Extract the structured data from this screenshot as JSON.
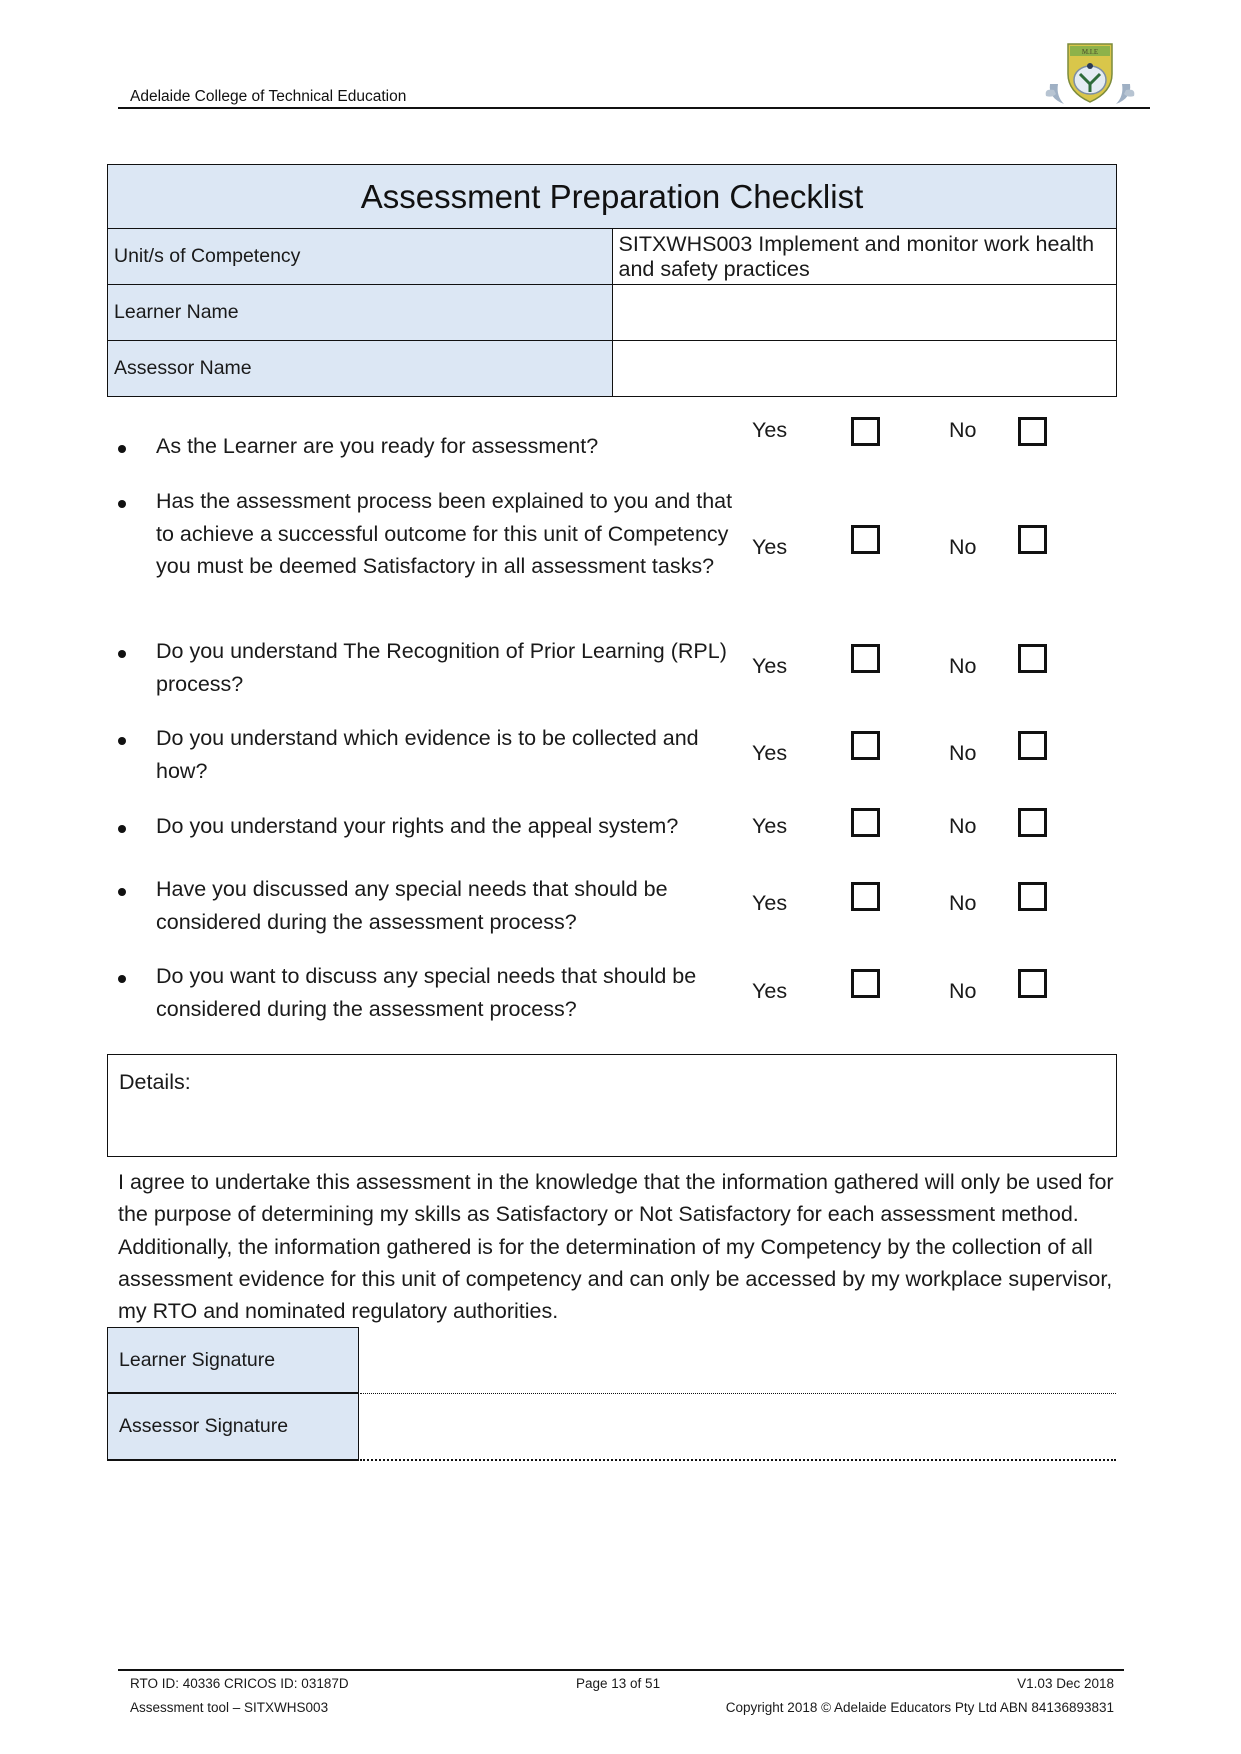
{
  "header": {
    "institution": "Adelaide College of Technical Education",
    "logo_icon": "college-crest-logo",
    "logo_text": "M.I.E"
  },
  "info_table": {
    "title": "Assessment Preparation Checklist",
    "rows": [
      {
        "label": "Unit/s of Competency",
        "value": "SITXWHS003 Implement and monitor work health and safety practices"
      },
      {
        "label": "Learner Name",
        "value": ""
      },
      {
        "label": "Assessor Name",
        "value": ""
      }
    ]
  },
  "checklist": {
    "yes_label": "Yes",
    "no_label": "No",
    "checkbox_icon": "empty-checkbox",
    "questions": [
      {
        "text": "As the Learner are you ready for assessment?",
        "yes_checked": false,
        "no_checked": false
      },
      {
        "text": "Has the assessment process been explained to you and that to achieve a successful outcome for this unit of Competency you must be deemed Satisfactory in all assessment tasks?",
        "yes_checked": false,
        "no_checked": false
      },
      {
        "text": "Do you understand The Recognition of Prior Learning (RPL) process?",
        "yes_checked": false,
        "no_checked": false
      },
      {
        "text": "Do you understand which evidence is to be collected and how?",
        "yes_checked": false,
        "no_checked": false
      },
      {
        "text": "Do you understand your rights and the appeal system?",
        "yes_checked": false,
        "no_checked": false
      },
      {
        "text": "Have you discussed any special needs that should be considered during the assessment process?",
        "yes_checked": false,
        "no_checked": false
      },
      {
        "text": "Do you want to discuss any special needs that should be considered during the assessment process?",
        "yes_checked": false,
        "no_checked": false
      }
    ]
  },
  "details": {
    "label": "Details:",
    "value": ""
  },
  "agreement": "I agree to undertake this assessment in the knowledge that the information gathered will only be used for the purpose of determining my skills as Satisfactory or Not Satisfactory for each assessment method. Additionally, the information gathered is for the determination of my Competency by the collection of all assessment evidence for this unit of competency and can only be accessed by my workplace supervisor, my RTO and nominated regulatory authorities.",
  "signatures": [
    {
      "label": "Learner Signature",
      "value": ""
    },
    {
      "label": "Assessor Signature",
      "value": ""
    }
  ],
  "footer": {
    "rto_ids": "RTO ID: 40336 CRICOS ID: 03187D",
    "page": "Page 13 of 51",
    "version": "V1.03 Dec 2018",
    "tool": "Assessment tool – SITXWHS003",
    "copyright": "Copyright 2018 © Adelaide Educators Pty Ltd ABN 84136893831"
  },
  "colors": {
    "label_fill": "#dce7f4",
    "border": "#111111",
    "text": "#1a1a1a"
  }
}
